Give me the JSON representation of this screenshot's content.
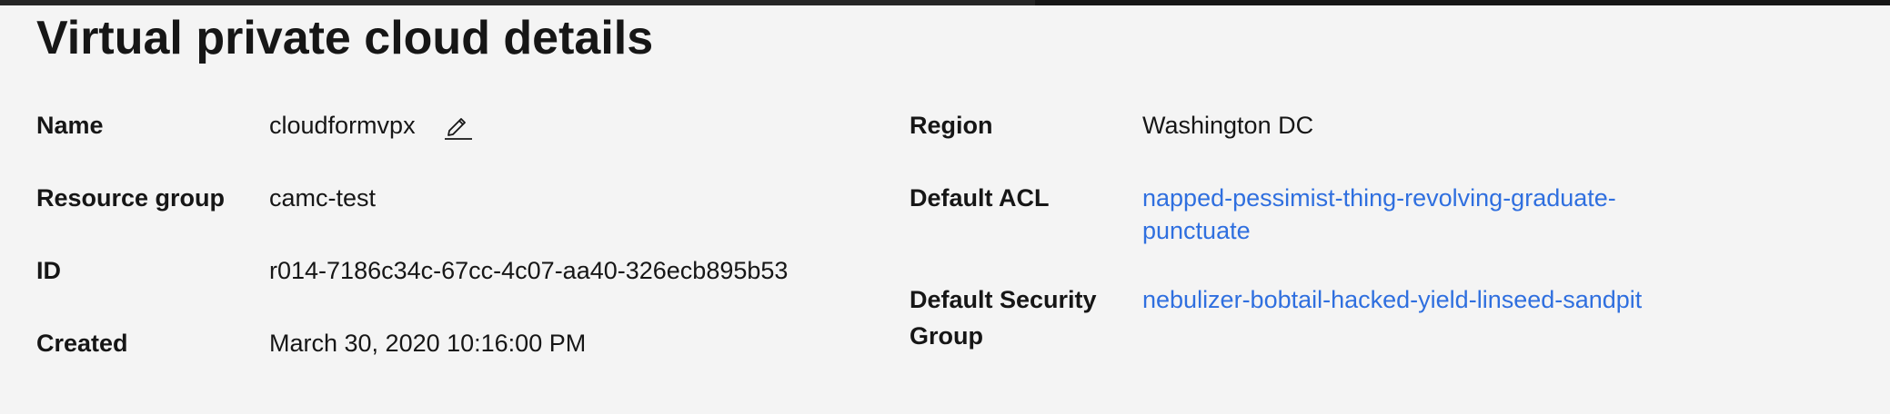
{
  "page": {
    "title": "Virtual private cloud details"
  },
  "details_left": {
    "name_label": "Name",
    "name_value": "cloudformvpx",
    "resource_group_label": "Resource group",
    "resource_group_value": "camc-test",
    "id_label": "ID",
    "id_value": "r014-7186c34c-67cc-4c07-aa40-326ecb895b53",
    "created_label": "Created",
    "created_value": "March 30, 2020 10:16:00 PM"
  },
  "details_right": {
    "region_label": "Region",
    "region_value": "Washington DC",
    "default_acl_label": "Default ACL",
    "default_acl_value": "napped-pessimist-thing-revolving-graduate-punctuate",
    "default_sg_label": "Default Security Group",
    "default_sg_value": "nebulizer-bobtail-hacked-yield-linseed-sandpit"
  },
  "icons": {
    "edit": "edit-pencil-icon"
  },
  "colors": {
    "background": "#f4f4f4",
    "text": "#161616",
    "link": "#2f6fdf"
  }
}
